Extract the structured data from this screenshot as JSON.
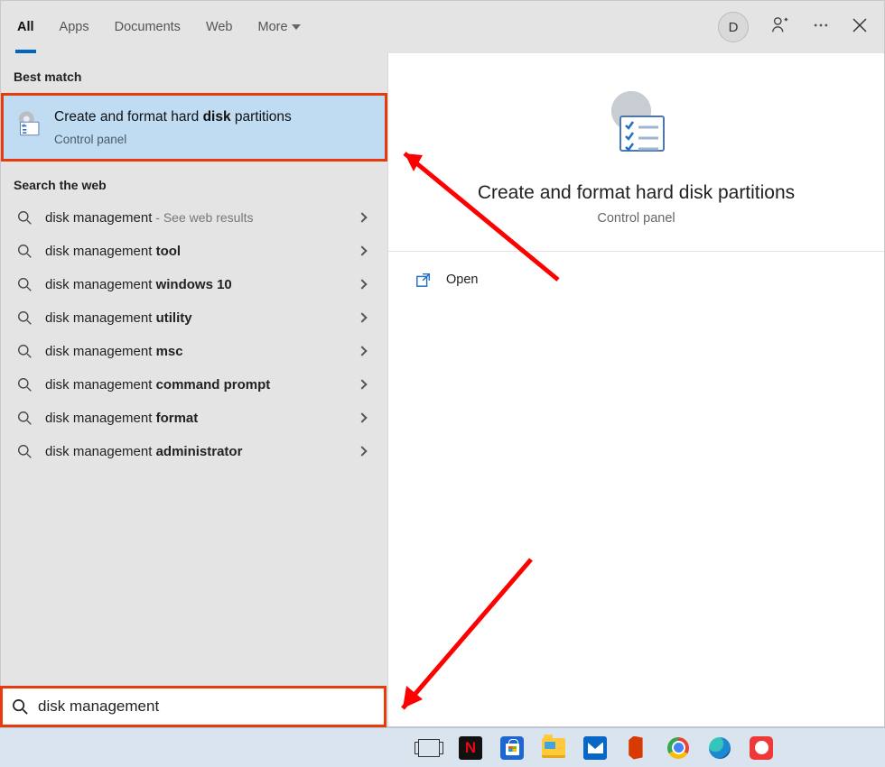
{
  "tabs": {
    "all": "All",
    "apps": "Apps",
    "documents": "Documents",
    "web": "Web",
    "more": "More"
  },
  "top_right": {
    "avatar_initial": "D"
  },
  "sections": {
    "best_match": "Best match",
    "search_web": "Search the web"
  },
  "best_match": {
    "title_prefix": "Create and format hard ",
    "title_bold": "disk",
    "title_suffix": " partitions",
    "subtitle": "Control panel"
  },
  "web_results": [
    {
      "prefix": "disk management",
      "bold": "",
      "hint": " - See web results"
    },
    {
      "prefix": "disk management ",
      "bold": "tool",
      "hint": ""
    },
    {
      "prefix": "disk management ",
      "bold": "windows 10",
      "hint": ""
    },
    {
      "prefix": "disk management ",
      "bold": "utility",
      "hint": ""
    },
    {
      "prefix": "disk management ",
      "bold": "msc",
      "hint": ""
    },
    {
      "prefix": "disk management ",
      "bold": "command prompt",
      "hint": ""
    },
    {
      "prefix": "disk management ",
      "bold": "format",
      "hint": ""
    },
    {
      "prefix": "disk management ",
      "bold": "administrator",
      "hint": ""
    }
  ],
  "preview": {
    "title": "Create and format hard disk partitions",
    "subtitle": "Control panel",
    "open_label": "Open"
  },
  "search_input": {
    "value": "disk management"
  },
  "taskbar": {
    "icons": [
      "task-view",
      "netflix",
      "microsoft-store",
      "file-explorer",
      "mail",
      "office",
      "chrome",
      "edge",
      "vivaldi"
    ]
  }
}
